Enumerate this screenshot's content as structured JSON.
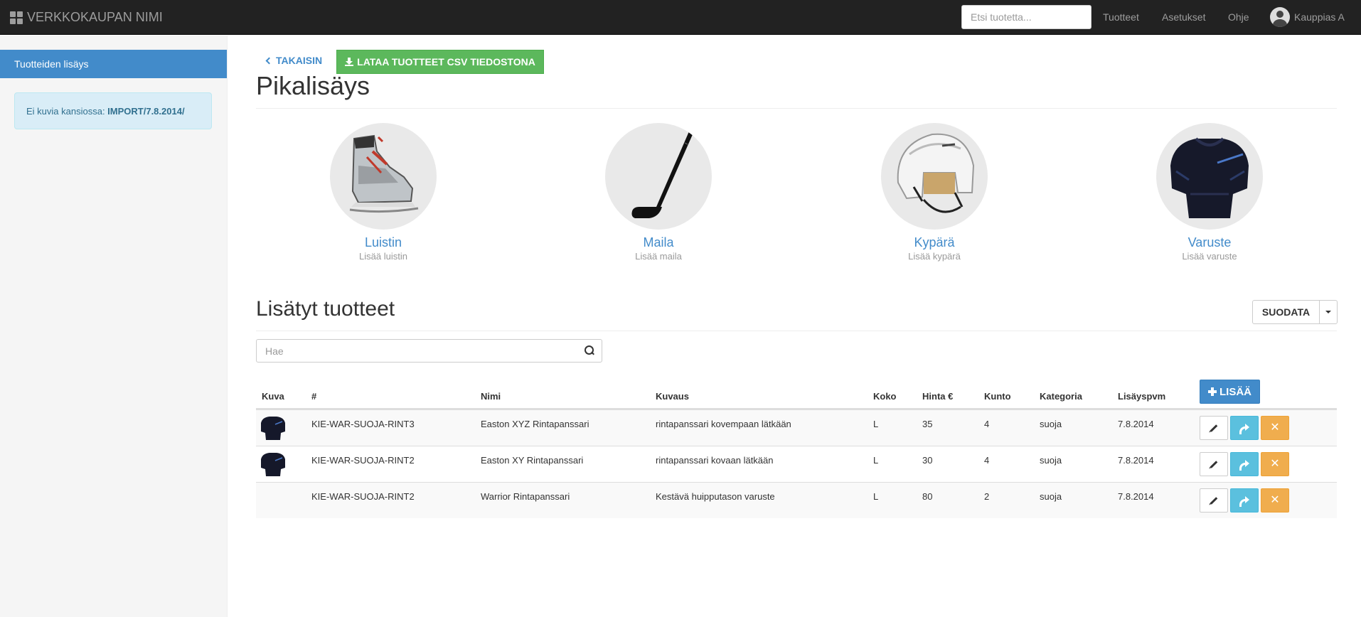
{
  "navbar": {
    "brand": "VERKKOKAUPAN NIMI",
    "search_placeholder": "Etsi tuotetta...",
    "links": [
      "Tuotteet",
      "Asetukset",
      "Ohje"
    ],
    "user": "Kauppias A"
  },
  "sidebar": {
    "active_item": "Tuotteiden lisäys",
    "alert_text": "Ei kuvia kansiossa: ",
    "alert_path": "IMPORT/7.8.2014/"
  },
  "toolbar": {
    "back_label": "TAKAISIN",
    "csv_label": "LATAA TUOTTEET CSV TIEDOSTONA"
  },
  "quick_add": {
    "title": "Pikalisäys",
    "items": [
      {
        "title": "Luistin",
        "subtitle": "Lisää luistin",
        "icon": "skate-icon"
      },
      {
        "title": "Maila",
        "subtitle": "Lisää maila",
        "icon": "hockey-stick-icon"
      },
      {
        "title": "Kypärä",
        "subtitle": "Lisää kypärä",
        "icon": "helmet-icon"
      },
      {
        "title": "Varuste",
        "subtitle": "Lisää varuste",
        "icon": "shoulder-pads-icon"
      }
    ]
  },
  "products": {
    "title": "Lisätyt tuotteet",
    "filter_label": "SUODATA",
    "search_placeholder": "Hae",
    "add_label": "LISÄÄ",
    "columns": [
      "Kuva",
      "#",
      "Nimi",
      "Kuvaus",
      "Koko",
      "Hinta €",
      "Kunto",
      "Kategoria",
      "Lisäyspvm"
    ],
    "rows": [
      {
        "has_image": true,
        "sku": "KIE-WAR-SUOJA-RINT3",
        "name": "Easton XYZ Rintapanssari",
        "description": "rintapanssari kovempaan lätkään",
        "size": "L",
        "price": "35",
        "condition": "4",
        "category": "suoja",
        "date": "7.8.2014"
      },
      {
        "has_image": true,
        "sku": "KIE-WAR-SUOJA-RINT2",
        "name": "Easton XY Rintapanssari",
        "description": "rintapanssari kovaan lätkään",
        "size": "L",
        "price": "30",
        "condition": "4",
        "category": "suoja",
        "date": "7.8.2014"
      },
      {
        "has_image": false,
        "sku": "KIE-WAR-SUOJA-RINT2",
        "name": "Warrior Rintapanssari",
        "description": "Kestävä huipputason varuste",
        "size": "L",
        "price": "80",
        "condition": "2",
        "category": "suoja",
        "date": "7.8.2014"
      }
    ]
  },
  "colors": {
    "primary": "#428bca",
    "success": "#5cb85c",
    "info": "#5bc0de",
    "warning": "#f0ad4e",
    "navbar": "#222222"
  }
}
